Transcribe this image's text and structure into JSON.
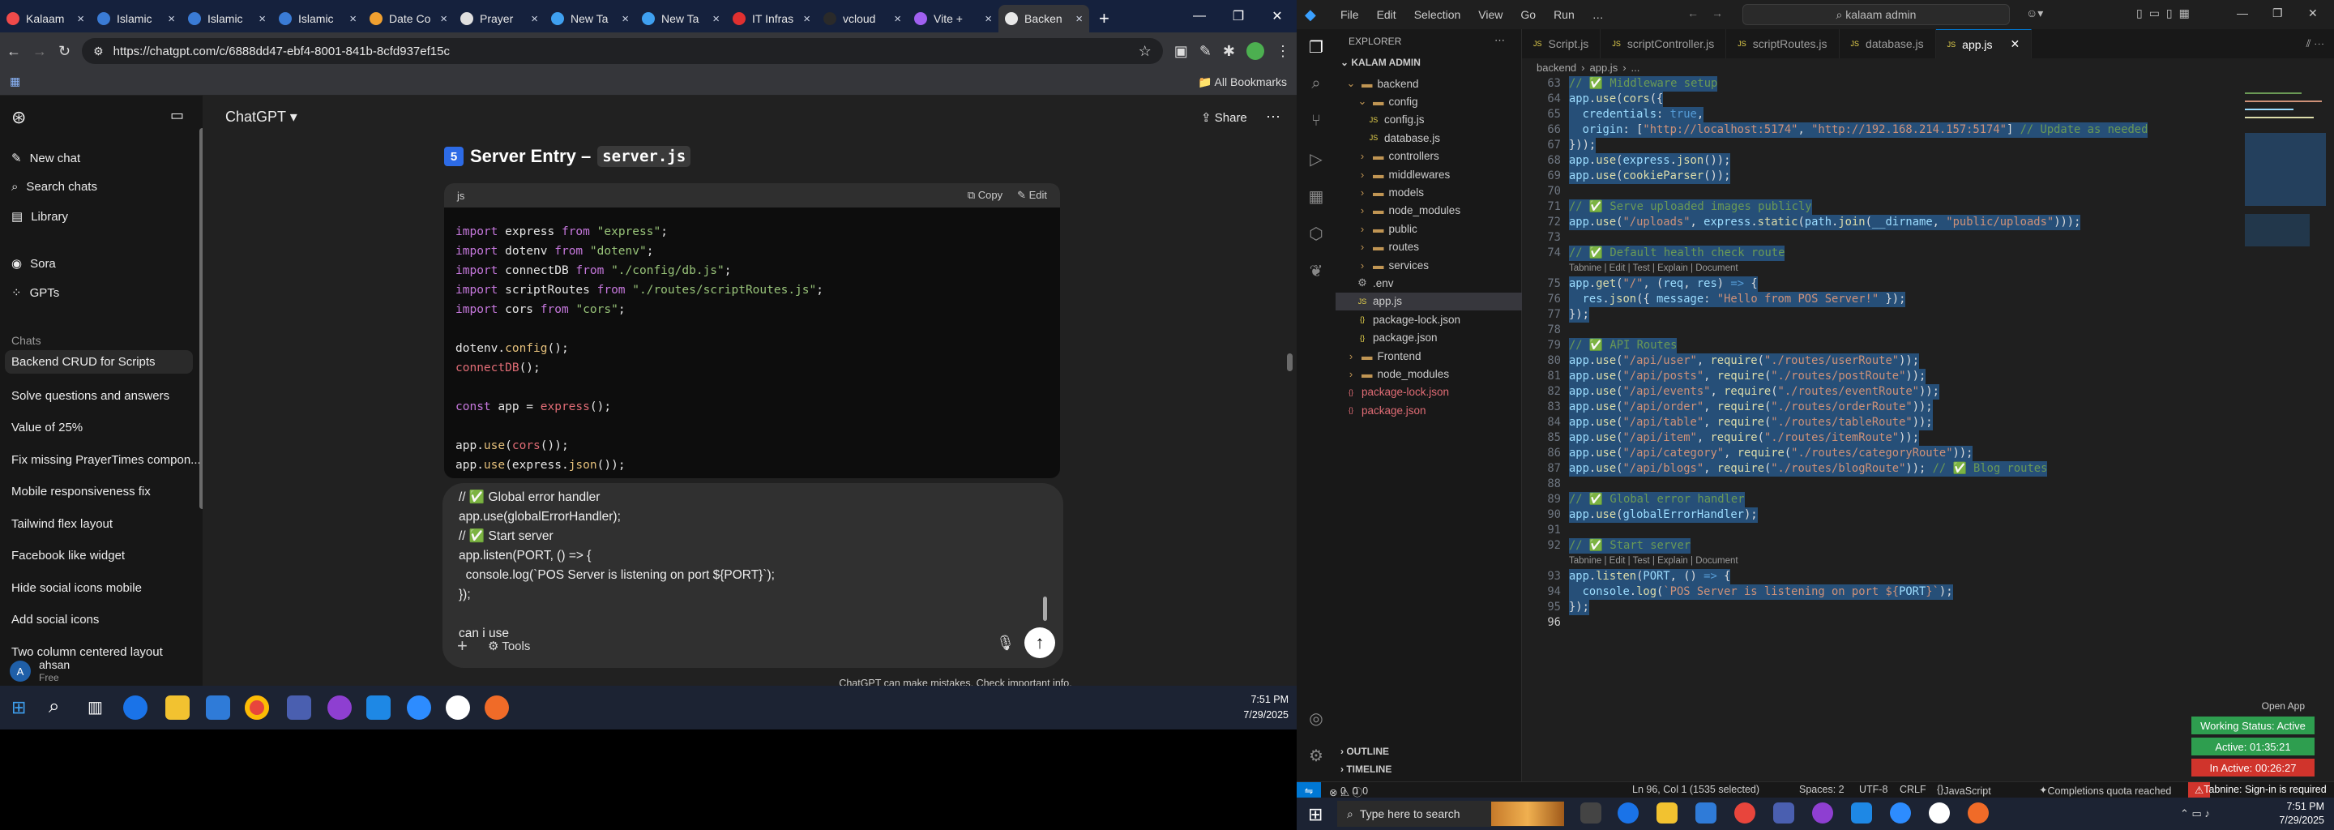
{
  "chrome": {
    "tabs": [
      {
        "label": "Kalaam",
        "color": "#f04a4a"
      },
      {
        "label": "Islamic",
        "color": "#3a7bd5"
      },
      {
        "label": "Islamic",
        "color": "#3a7bd5"
      },
      {
        "label": "Islamic",
        "color": "#3a7bd5"
      },
      {
        "label": "Date Co",
        "color": "#f0a030"
      },
      {
        "label": "Prayer",
        "color": "#e0e0e0"
      },
      {
        "label": "New Ta",
        "color": "#3fa0f0"
      },
      {
        "label": "New Ta",
        "color": "#3fa0f0"
      },
      {
        "label": "IT Infras",
        "color": "#e03030"
      },
      {
        "label": "vcloud",
        "color": "#2a2a2a"
      },
      {
        "label": "Vite +",
        "color": "#a060f0"
      },
      {
        "label": "Backen",
        "color": "#e8e8e8"
      }
    ],
    "close_glyph": "×",
    "newtab_glyph": "+",
    "url": "https://chatgpt.com/c/6888dd47-ebf4-8001-841b-8cfd937ef15c",
    "all_bookmarks": "All Bookmarks"
  },
  "chatgpt": {
    "sidebar": {
      "new_chat": "New chat",
      "search_chats": "Search chats",
      "library": "Library",
      "sora": "Sora",
      "gpts": "GPTs",
      "chats_heading": "Chats",
      "chats": [
        "Backend CRUD for Scripts",
        "Solve questions and answers",
        "Value of 25%",
        "Fix missing PrayerTimes compon...",
        "Mobile responsiveness fix",
        "Tailwind flex layout",
        "Facebook like widget",
        "Hide social icons mobile",
        "Add social icons",
        "Two column centered layout"
      ],
      "user_name": "ahsan",
      "user_plan": "Free",
      "avatar_letter": "A"
    },
    "header_title": "ChatGPT",
    "share": "Share",
    "section_number": "5",
    "section_title": "Server Entry –",
    "section_file": "server.js",
    "code_lang": "js",
    "copy": "Copy",
    "edit": "Edit",
    "composer_lines": [
      "// ✅ Global error handler",
      "app.use(globalErrorHandler);",
      "// ✅ Start server",
      "app.listen(PORT, () => {",
      "  console.log(`POS Server is listening on port ${PORT}`);",
      "});",
      "",
      "can i use"
    ],
    "tools": "Tools",
    "disclaimer": "ChatGPT can make mistakes. Check important info."
  },
  "taskbar_left": {
    "time": "7:51 PM",
    "date": "7/29/2025"
  },
  "vscode": {
    "menu": [
      "File",
      "Edit",
      "Selection",
      "View",
      "Go",
      "Run",
      "…"
    ],
    "search": "kalaam admin",
    "explorer_title": "EXPLORER",
    "workspace": "KALAM ADMIN",
    "tree": [
      {
        "name": "backend",
        "depth": 0,
        "type": "folder-open"
      },
      {
        "name": "config",
        "depth": 1,
        "type": "folder-open"
      },
      {
        "name": "config.js",
        "depth": 2,
        "type": "js"
      },
      {
        "name": "database.js",
        "depth": 2,
        "type": "js"
      },
      {
        "name": "controllers",
        "depth": 1,
        "type": "folder"
      },
      {
        "name": "middlewares",
        "depth": 1,
        "type": "folder"
      },
      {
        "name": "models",
        "depth": 1,
        "type": "folder"
      },
      {
        "name": "node_modules",
        "depth": 1,
        "type": "folder"
      },
      {
        "name": "public",
        "depth": 1,
        "type": "folder"
      },
      {
        "name": "routes",
        "depth": 1,
        "type": "folder"
      },
      {
        "name": "services",
        "depth": 1,
        "type": "folder"
      },
      {
        "name": ".env",
        "depth": 1,
        "type": "env"
      },
      {
        "name": "app.js",
        "depth": 1,
        "type": "js"
      },
      {
        "name": "package-lock.json",
        "depth": 1,
        "type": "json"
      },
      {
        "name": "package.json",
        "depth": 1,
        "type": "json"
      },
      {
        "name": "Frontend",
        "depth": 0,
        "type": "folder"
      },
      {
        "name": "node_modules",
        "depth": 0,
        "type": "folder"
      },
      {
        "name": "package-lock.json",
        "depth": 0,
        "type": "json-red"
      },
      {
        "name": "package.json",
        "depth": 0,
        "type": "json-red"
      }
    ],
    "outline": "OUTLINE",
    "timeline": "TIMELINE",
    "tabs": [
      "Script.js",
      "scriptController.js",
      "scriptRoutes.js",
      "database.js",
      "app.js"
    ],
    "breadcrumb": [
      "backend",
      "app.js",
      "..."
    ],
    "lens_text": "Tabnine | Edit | Test | Explain | Document",
    "status": {
      "errors": "0",
      "warnings": "0",
      "infos": "0",
      "cursor": "Ln 96, Col 1 (1535 selected)",
      "spaces": "Spaces: 2",
      "encoding": "UTF-8",
      "eol": "CRLF",
      "language": "JavaScript",
      "quota": "Completions quota reached",
      "tabnine": "Tabnine: Sign-in is required"
    },
    "badges": {
      "open_app": "Open App",
      "working": "Working Status: Active",
      "active": "Active: 01:35:21",
      "inactive": "In Active: 00:26:27"
    }
  },
  "taskbar_right": {
    "search": "Type here to search",
    "time": "7:51 PM",
    "date": "7/29/2025"
  }
}
